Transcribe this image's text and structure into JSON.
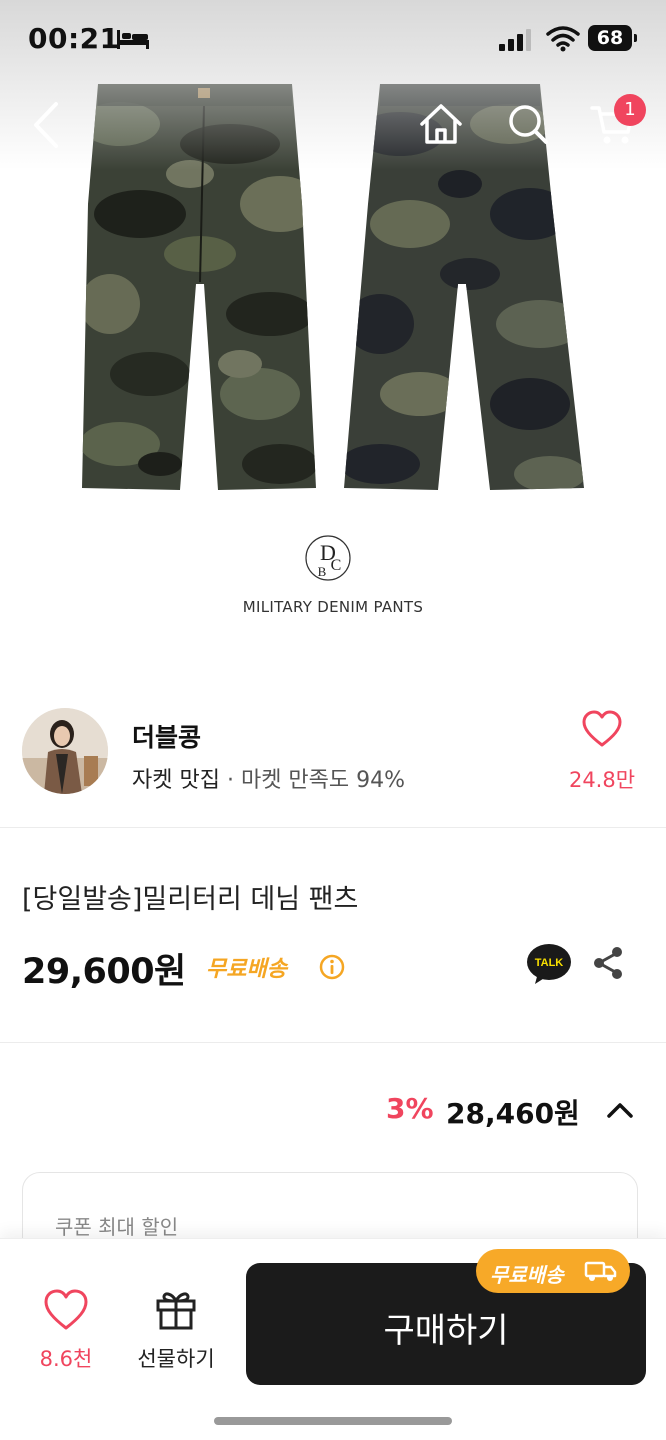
{
  "status_bar": {
    "time": "00:21",
    "battery": "68"
  },
  "header": {
    "cart_count": "1"
  },
  "hero": {
    "caption": "MILITARY DENIM PANTS",
    "logo_text": "DBC"
  },
  "seller": {
    "name": "더블콩",
    "tagline": "자켓 맛집",
    "satisfaction": " · 마켓 만족도 94%",
    "likes": "24.8만"
  },
  "product": {
    "title": "[당일발송]밀리터리 데님 팬츠",
    "price": "29,600원",
    "shipping": "무료배송",
    "talk_label": "TALK"
  },
  "discount": {
    "rate": "3%",
    "price": "28,460원"
  },
  "coupon": {
    "label": "쿠폰 최대 할인"
  },
  "bottom_bar": {
    "wish_count": "8.6천",
    "gift_label": "선물하기",
    "buy_label": "구매하기",
    "ship_tag": "무료배송"
  },
  "colors": {
    "accent_pink": "#f0455e",
    "shipping_orange": "#f5a623",
    "buy_button": "#1b1b1b"
  },
  "icons": [
    "bed-icon",
    "signal-icon",
    "wifi-icon",
    "back-icon",
    "home-icon",
    "search-icon",
    "cart-icon",
    "heart-icon",
    "info-icon",
    "kakao-talk-icon",
    "share-icon",
    "chevron-up-icon",
    "gift-icon",
    "truck-icon"
  ]
}
